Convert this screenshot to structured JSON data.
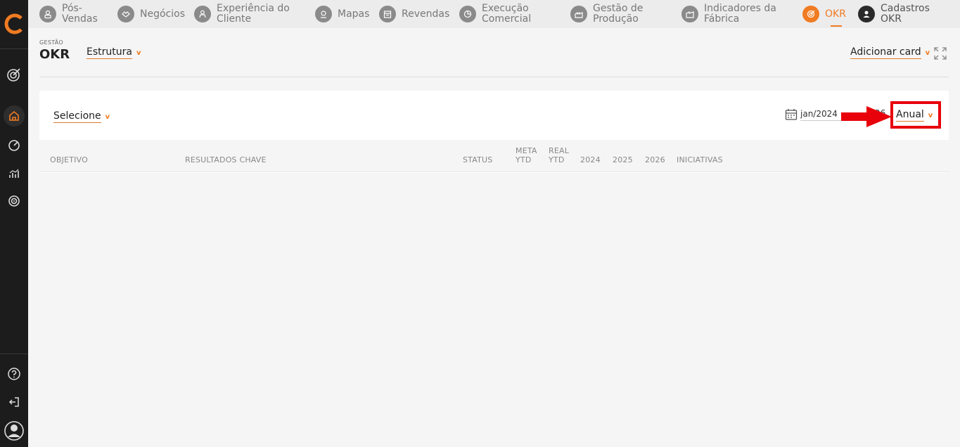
{
  "nav": {
    "items": [
      {
        "label": "Pós-\nVendas",
        "icon": "person-icon"
      },
      {
        "label": "Negócios",
        "icon": "handshake-icon"
      },
      {
        "label": "Experiência do\nCliente",
        "icon": "customer-icon"
      },
      {
        "label": "Mapas",
        "icon": "map-pin-icon"
      },
      {
        "label": "Revendas",
        "icon": "store-icon"
      },
      {
        "label": "Execução\nComercial",
        "icon": "pie-chart-icon"
      },
      {
        "label": "Gestão de\nProdução",
        "icon": "factory-icon"
      },
      {
        "label": "Indicadores da\nFábrica",
        "icon": "industry-icon"
      },
      {
        "label": "OKR",
        "icon": "target-icon"
      },
      {
        "label": "Cadastros\nOKR",
        "icon": "user-icon"
      }
    ]
  },
  "header": {
    "section_caption": "GESTÃO",
    "title": "OKR",
    "structure_dropdown": "Estrutura",
    "add_card": "Adicionar card"
  },
  "filters": {
    "select_dropdown": "Selecione",
    "date_start": "jan/2024",
    "date_end_partial": "26",
    "period_dropdown": "Anual"
  },
  "table": {
    "columns": {
      "objetivo": "OBJETIVO",
      "resultados": "RESULTADOS CHAVE",
      "status": "STATUS",
      "meta": "META\nYTD",
      "real": "REAL\nYTD",
      "y2024": "2024",
      "y2025": "2025",
      "y2026": "2026",
      "iniciativas": "INICIATIVAS"
    }
  },
  "colors": {
    "accent": "#f07b22",
    "sidebar_bg": "#1c1c1c",
    "highlight": "#e8000b"
  }
}
